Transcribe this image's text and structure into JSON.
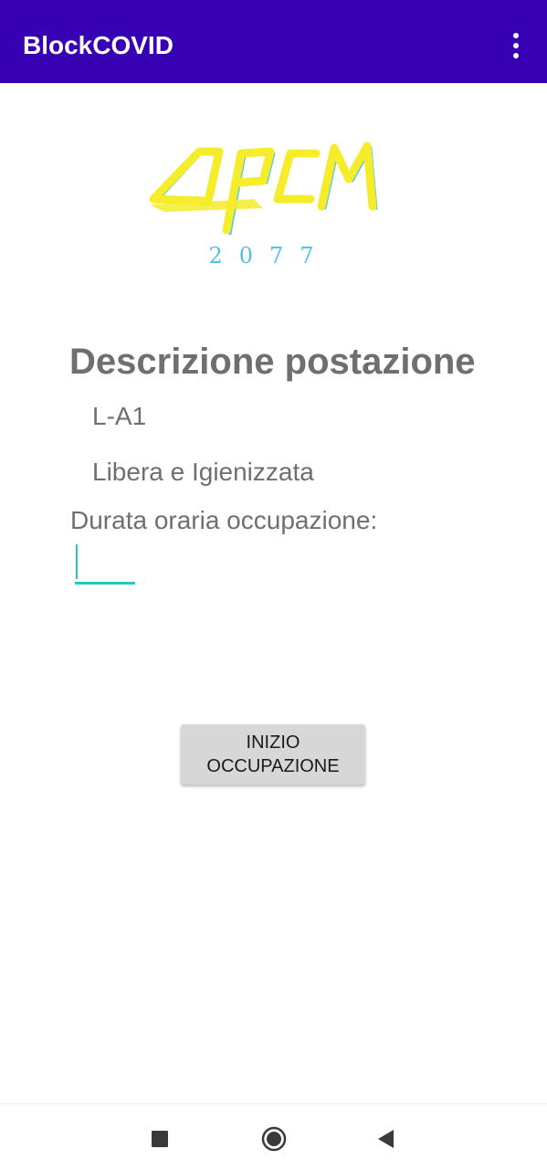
{
  "app_bar": {
    "title": "BlockCOVID",
    "menu_icon": "more-vert-icon"
  },
  "logo": {
    "text": "DPCM",
    "year": "2077",
    "primary_color": "#F5EC2A",
    "accent_color": "#4FC3E3"
  },
  "station": {
    "section_title": "Descrizione postazione",
    "id": "L-A1",
    "status": "Libera e Igienizzata"
  },
  "duration": {
    "label": "Durata oraria occupazione:",
    "value": ""
  },
  "actions": {
    "start_label": "INIZIO OCCUPAZIONE"
  },
  "nav": {
    "recents_icon": "square-icon",
    "home_icon": "circle-icon",
    "back_icon": "triangle-back-icon"
  },
  "colors": {
    "app_bar": "#3700B3",
    "text_gray": "#6F6F6F",
    "input_accent": "#26C6C6",
    "button_bg": "#D7D7D7"
  }
}
